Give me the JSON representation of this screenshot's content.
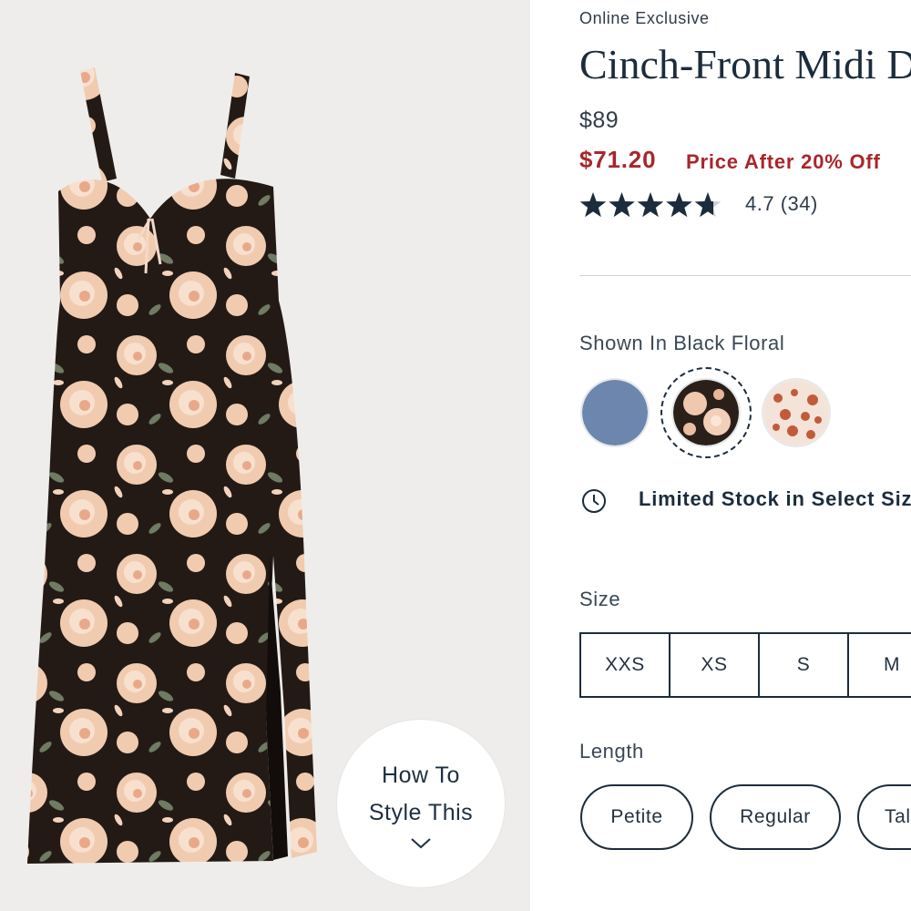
{
  "product": {
    "badge": "Online Exclusive",
    "title": "Cinch-Front Midi Dress",
    "original_price": "$89",
    "sale_price": "$71.20",
    "sale_note": "Price After 20% Off",
    "rating_text": "4.7 (34)",
    "rating_value": 4.7,
    "rating_max": 5
  },
  "color": {
    "label": "Shown In Black Floral",
    "swatches": [
      {
        "name": "Blue",
        "color": "#6c86ad",
        "selected": false
      },
      {
        "name": "Black Floral",
        "color": "#3a2a22",
        "selected": true
      },
      {
        "name": "Red Floral",
        "color": "#c25a3c",
        "selected": false
      }
    ]
  },
  "stock": {
    "text": "Limited Stock in Select Sizes",
    "icon": "clock-icon"
  },
  "size": {
    "label": "Size",
    "options": [
      "XXS",
      "XS",
      "S",
      "M"
    ]
  },
  "length": {
    "label": "Length",
    "options": [
      "Petite",
      "Regular",
      "Tall"
    ]
  },
  "style_cta": {
    "line1": "How To",
    "line2": "Style This",
    "icon": "chevron-down-icon"
  },
  "colors": {
    "text_primary": "#1c2c3c",
    "sale_red": "#a8262b",
    "image_bg": "#efedeb",
    "dress_base": "#231a16",
    "flower_peach": "#f2cdb2"
  }
}
